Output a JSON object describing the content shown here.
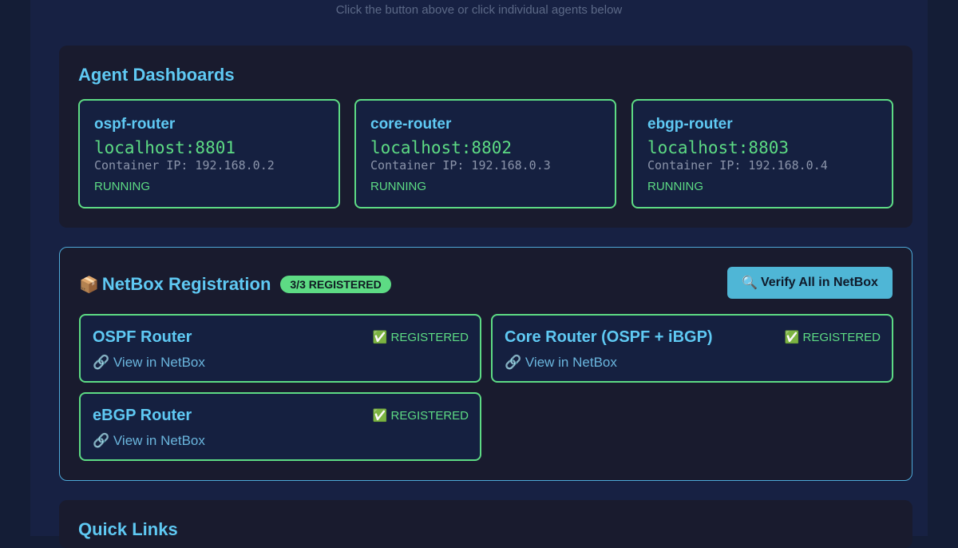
{
  "hint": "Click the button above or click individual agents below",
  "dashboards": {
    "title": "Agent Dashboards",
    "agents": [
      {
        "name": "ospf-router",
        "host": "localhost:8801",
        "ip": "Container IP: 192.168.0.2",
        "status": "RUNNING"
      },
      {
        "name": "core-router",
        "host": "localhost:8802",
        "ip": "Container IP: 192.168.0.3",
        "status": "RUNNING"
      },
      {
        "name": "ebgp-router",
        "host": "localhost:8803",
        "ip": "Container IP: 192.168.0.4",
        "status": "RUNNING"
      }
    ]
  },
  "netbox": {
    "icon": "📦",
    "title": "NetBox Registration",
    "badge": "3/3 REGISTERED",
    "verify_icon": "🔍",
    "verify_label": "Verify All in NetBox",
    "cards": [
      {
        "name": "OSPF Router",
        "status": "✅ REGISTERED",
        "link": "🔗 View in NetBox"
      },
      {
        "name": "Core Router (OSPF + iBGP)",
        "status": "✅ REGISTERED",
        "link": "🔗 View in NetBox"
      },
      {
        "name": "eBGP Router",
        "status": "✅ REGISTERED",
        "link": "🔗 View in NetBox"
      }
    ]
  },
  "quick_links": {
    "title": "Quick Links"
  },
  "colors": {
    "accent": "#5fc9f3",
    "success": "#5ddb84",
    "button": "#4fb6d6",
    "panel": "#191b2e"
  }
}
